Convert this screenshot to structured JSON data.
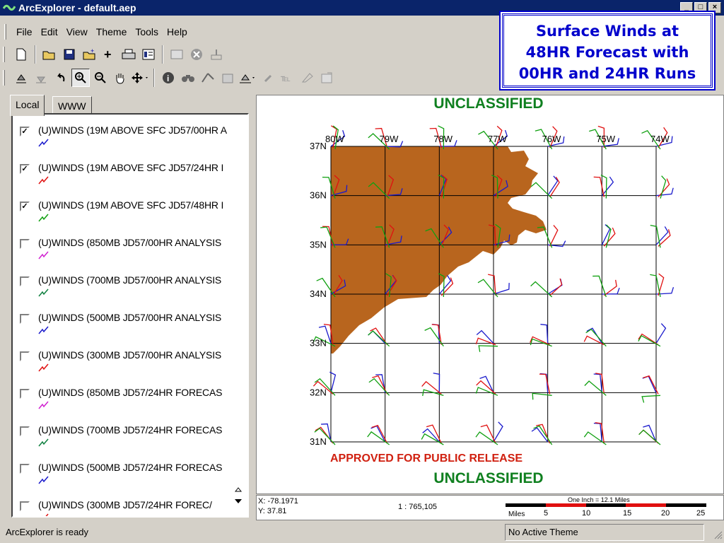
{
  "window": {
    "title": "ArcExplorer - default.aep",
    "controls": [
      "_",
      "□",
      "×"
    ]
  },
  "menu": [
    "File",
    "Edit",
    "View",
    "Theme",
    "Tools",
    "Help"
  ],
  "callout": {
    "line1": "Surface Winds at",
    "line2": "48HR Forecast with",
    "line3": "00HR and 24HR Runs"
  },
  "tabs": {
    "local": "Local",
    "www": "WWW"
  },
  "layers": [
    {
      "label": "(U)WINDS (19M ABOVE SFC JD57/00HR A",
      "checked": true,
      "color": "#1a1acc"
    },
    {
      "label": "(U)WINDS (19M ABOVE SFC JD57/24HR I",
      "checked": true,
      "color": "#e01010"
    },
    {
      "label": "(U)WINDS (19M ABOVE SFC JD57/48HR I",
      "checked": true,
      "color": "#10a010"
    },
    {
      "label": "(U)WINDS (850MB JD57/00HR ANALYSIS",
      "checked": false,
      "color": "#d020d0"
    },
    {
      "label": "(U)WINDS (700MB JD57/00HR ANALYSIS",
      "checked": false,
      "color": "#108040"
    },
    {
      "label": "(U)WINDS (500MB JD57/00HR ANALYSIS",
      "checked": false,
      "color": "#1a1acc"
    },
    {
      "label": "(U)WINDS (300MB JD57/00HR ANALYSIS",
      "checked": false,
      "color": "#e01010"
    },
    {
      "label": "(U)WINDS (850MB JD57/24HR FORECAS",
      "checked": false,
      "color": "#d020d0"
    },
    {
      "label": "(U)WINDS (700MB JD57/24HR FORECAS",
      "checked": false,
      "color": "#108040"
    },
    {
      "label": "(U)WINDS (500MB JD57/24HR FORECAS",
      "checked": false,
      "color": "#1a1acc"
    },
    {
      "label": "(U)WINDS (300MB JD57/24HR FOREC/",
      "checked": false,
      "color": "#e01010"
    }
  ],
  "map": {
    "header": "UNCLASSIFIED",
    "footer": "UNCLASSIFIED",
    "release": "APPROVED FOR PUBLIC RELEASE",
    "lon_labels": [
      "80W",
      "79W",
      "78W",
      "77W",
      "76W",
      "75W",
      "74W"
    ],
    "lat_labels": [
      "37N",
      "36N",
      "35N",
      "34N",
      "33N",
      "32N",
      "31N"
    ],
    "land_color": "#b8651e"
  },
  "coords": {
    "x": "X: -78.1971",
    "y": "Y: 37.81",
    "scale": "1 : 765,105"
  },
  "scalebar": {
    "title": "One Inch = 12.1 Miles",
    "unit": "Miles",
    "ticks": [
      "5",
      "10",
      "15",
      "20",
      "25"
    ]
  },
  "status": {
    "left": "ArcExplorer is ready",
    "right": "No Active Theme"
  },
  "icons": [
    "new-file-icon",
    "open-icon",
    "save-icon",
    "add-theme-icon",
    "add-layer-icon",
    "print-icon",
    "legend-icon",
    "table-icon",
    "stop-icon",
    "export-icon",
    "theme-up-icon",
    "theme-down-icon",
    "undo-icon",
    "zoom-in-icon",
    "zoom-out-icon",
    "pan-icon",
    "move-icon",
    "identify-icon",
    "find-icon",
    "measure-icon",
    "query-icon",
    "address-icon",
    "hotlink-icon",
    "label-icon",
    "eraser-icon",
    "properties-icon"
  ]
}
